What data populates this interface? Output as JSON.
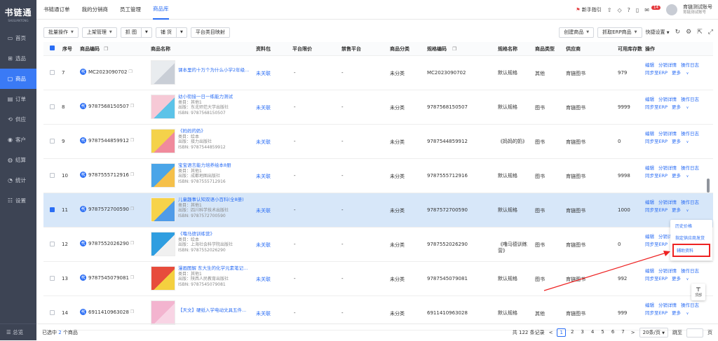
{
  "sidebar": {
    "logo_title": "书链通",
    "logo_sub": "SHULIANTONG",
    "items": [
      {
        "label": "首页",
        "icon": "▭",
        "active": false
      },
      {
        "label": "选品",
        "icon": "⊞",
        "active": false
      },
      {
        "label": "商品",
        "icon": "▢",
        "active": true
      },
      {
        "label": "订单",
        "icon": "▤",
        "active": false
      },
      {
        "label": "供应",
        "icon": "⟲",
        "active": false
      },
      {
        "label": "客户",
        "icon": "◉",
        "active": false
      },
      {
        "label": "结算",
        "icon": "◍",
        "active": false
      },
      {
        "label": "统计",
        "icon": "◔",
        "active": false
      },
      {
        "label": "设置",
        "icon": "☷",
        "active": false
      }
    ],
    "bottom_label": "☰ 总览"
  },
  "topbar": {
    "tabs": [
      "书链通订单",
      "我的分销商",
      "员工管理",
      "商品库"
    ],
    "active_tab": 3,
    "guide": "新手指引",
    "notif_count": "14",
    "account_name": "育链测试账号",
    "account_sub": "育链测试账号"
  },
  "toolbar": {
    "batch": "批量操作",
    "shelf": "上架管理",
    "grab": "抓 图",
    "supply": "铺 货",
    "map": "平台类目映射",
    "create": "创建商品",
    "erp": "抓取ERP商品",
    "quick": "快捷设置"
  },
  "table": {
    "headers": [
      "序号",
      "商品编码",
      "商品名称",
      "资料包",
      "平台限价",
      "禁售平台",
      "商品分类",
      "规格编码",
      "规格名称",
      "商品类型",
      "供应商",
      "可用库存数",
      "操作"
    ],
    "rows": [
      {
        "no": "7",
        "sku": "MC2023090702",
        "name": "课本里的十万个为什么小学2年级...",
        "lines": [],
        "pack": "未关联",
        "limit": "-",
        "ban": "-",
        "cat": "未分类",
        "spec_code": "MC2023090702",
        "spec_name": "默认规格",
        "type": "其他",
        "supplier": "育链图书",
        "stock": "979",
        "selected": false
      },
      {
        "no": "8",
        "sku": "9787568150507",
        "name": "幼小衔接一日一练能力测试",
        "lines": [
          "类目：其他1",
          "出版：东北师范大学出版社",
          "ISBN: 9787568150507"
        ],
        "pack": "未关联",
        "limit": "-",
        "ban": "-",
        "cat": "未分类",
        "spec_code": "9787568150507",
        "spec_name": "默认规格",
        "type": "图书",
        "supplier": "育链图书",
        "stock": "9999",
        "selected": false
      },
      {
        "no": "9",
        "sku": "9787544859912",
        "name": "《妈妈的奶》",
        "lines": [
          "类目：绘本",
          "出版：接力出版社",
          "ISBN: 9787544859912"
        ],
        "pack": "未关联",
        "limit": "-",
        "ban": "-",
        "cat": "未分类",
        "spec_code": "9787544859912",
        "spec_name": "《妈妈的奶》",
        "type": "图书",
        "supplier": "育链图书",
        "stock": "0",
        "selected": false
      },
      {
        "no": "10",
        "sku": "9787555712916",
        "name": "宝宝语言能力培养绘本8册",
        "lines": [
          "类目：其他1",
          "出版：成都地图出版社",
          "ISBN: 9787555712916"
        ],
        "pack": "未关联",
        "limit": "-",
        "ban": "-",
        "cat": "未分类",
        "spec_code": "9787555712916",
        "spec_name": "默认规格",
        "type": "图书",
        "supplier": "育链图书",
        "stock": "9998",
        "selected": false
      },
      {
        "no": "11",
        "sku": "9787572700590",
        "name": "儿童趣事认知双语小百科(全8册)",
        "lines": [
          "类目：其他1",
          "出版：四川科学技术出版社",
          "ISBN: 9787572700590"
        ],
        "pack": "未关联",
        "limit": "-",
        "ban": "-",
        "cat": "未分类",
        "spec_code": "9787572700590",
        "spec_name": "默认规格",
        "type": "图书",
        "supplier": "育链图书",
        "stock": "1000",
        "selected": true
      },
      {
        "no": "12",
        "sku": "9787552026290",
        "name": "《噜马德训练营》",
        "lines": [
          "类目：绘本",
          "出版：上海社会科学院出版社",
          "ISBN: 9787552026290"
        ],
        "pack": "未关联",
        "limit": "-",
        "ban": "-",
        "cat": "未分类",
        "spec_code": "9787552026290",
        "spec_name": "《噜马德训练营》",
        "type": "图书",
        "supplier": "育链图书",
        "stock": "0",
        "selected": false
      },
      {
        "no": "13",
        "sku": "9787545079081",
        "name": "漫画图解 东大生的化学元素笔记...",
        "lines": [
          "类目：其他1",
          "出版：陕西人民教育出版社",
          "ISBN: 9787545079081"
        ],
        "pack": "未关联",
        "limit": "-",
        "ban": "-",
        "cat": "未分类",
        "spec_code": "9787545079081",
        "spec_name": "默认规格",
        "type": "图书",
        "supplier": "育链图书",
        "stock": "992",
        "selected": false
      },
      {
        "no": "14",
        "sku": "6911410963028",
        "name": "【天文】硬纸入学电动文具五件...",
        "lines": [],
        "pack": "未关联",
        "limit": "-",
        "ban": "-",
        "cat": "未分类",
        "spec_code": "6911410963028",
        "spec_name": "默认规格",
        "type": "其他",
        "supplier": "育链图书",
        "stock": "999",
        "selected": false
      }
    ],
    "ops": {
      "edit": "编辑",
      "detail": "分销详情",
      "log": "操作日志",
      "sync": "同步至ERP",
      "more": "更多"
    }
  },
  "popup": {
    "items": [
      "历史价格",
      "指定供应商发货",
      "辅助资料"
    ]
  },
  "to_top": "顶部",
  "footer": {
    "selected_prefix": "已选中",
    "selected_count": "2",
    "selected_suffix": "个商品",
    "total": "共 122 条记录",
    "pages": [
      "1",
      "2",
      "3",
      "4",
      "5",
      "6",
      "7"
    ],
    "current_page": "1",
    "page_size": "20条/页",
    "jump": "跳至",
    "page_unit": "页"
  },
  "colors": {
    "accent": "#2a6df4",
    "sidebar": "#3d4454",
    "selected_row": "#d7e7f9",
    "annotation": "#e22222"
  }
}
